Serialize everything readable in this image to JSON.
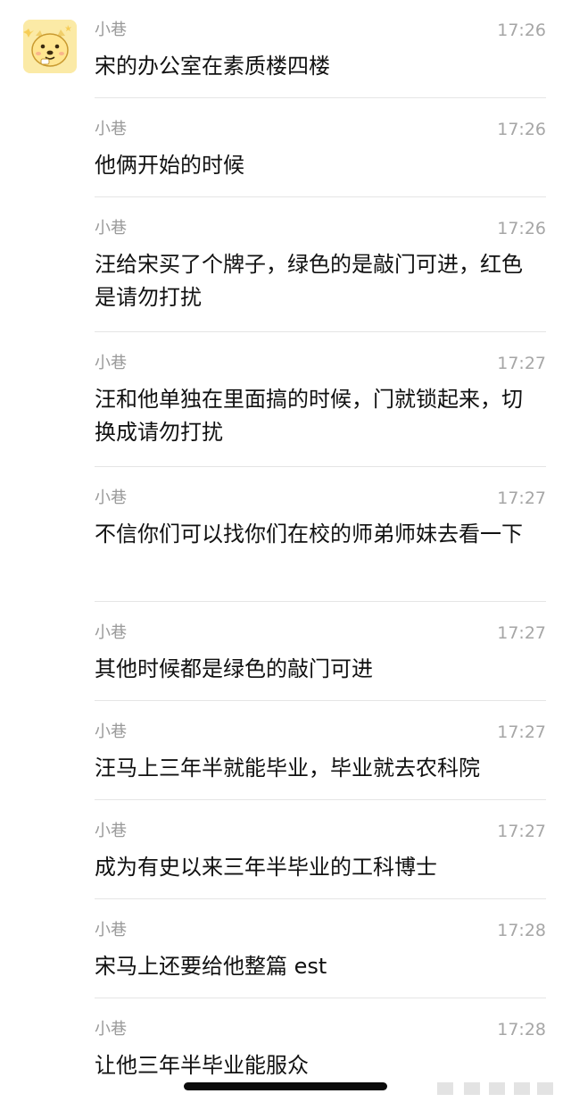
{
  "messages": [
    {
      "sender": "小巷",
      "time": "17:26",
      "text": "宋的办公室在素质楼四楼"
    },
    {
      "sender": "小巷",
      "time": "17:26",
      "text": "他俩开始的时候"
    },
    {
      "sender": "小巷",
      "time": "17:26",
      "text": "汪给宋买了个牌子，绿色的是敲门可进，红色是请勿打扰"
    },
    {
      "sender": "小巷",
      "time": "17:27",
      "text": "汪和他单独在里面搞的时候，门就锁起来，切换成请勿打扰"
    },
    {
      "sender": "小巷",
      "time": "17:27",
      "text": "不信你们可以找你们在校的师弟师妹去看一下"
    },
    {
      "sender": "小巷",
      "time": "17:27",
      "text": "其他时候都是绿色的敲门可进"
    },
    {
      "sender": "小巷",
      "time": "17:27",
      "text": "汪马上三年半就能毕业，毕业就去农科院"
    },
    {
      "sender": "小巷",
      "time": "17:27",
      "text": "成为有史以来三年半毕业的工科博士"
    },
    {
      "sender": "小巷",
      "time": "17:28",
      "text": "宋马上还要给他整篇 est"
    },
    {
      "sender": "小巷",
      "time": "17:28",
      "text": "让他三年半毕业能服众"
    }
  ],
  "colors": {
    "background": "#ffffff",
    "sender_text": "#9a9a9a",
    "time_text": "#a6a6a6",
    "message_text": "#111111",
    "divider": "#e5e5e5",
    "avatar_background": "#fbeaa6"
  },
  "icons": {
    "avatar": "cartoon-dog-avatar"
  }
}
